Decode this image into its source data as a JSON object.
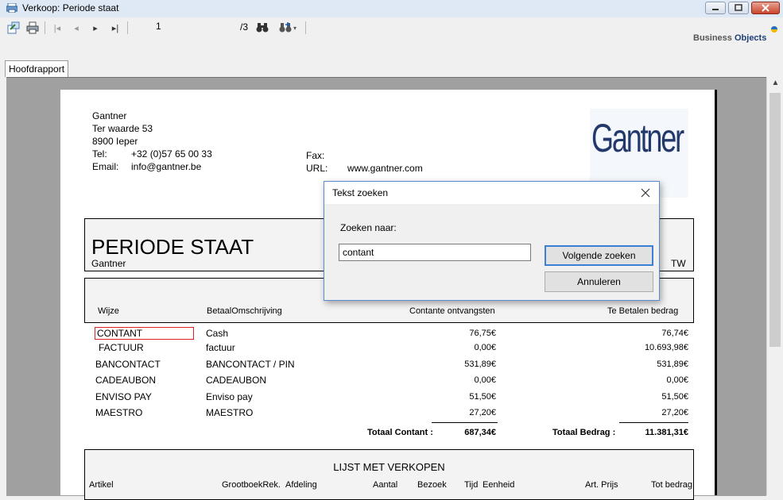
{
  "window": {
    "title": "Verkoop: Periode staat"
  },
  "toolbar": {
    "page_current": "1",
    "page_total": "/3",
    "brand_business": "Business",
    "brand_objects": "Objects"
  },
  "tab": {
    "label": "Hoofdrapport"
  },
  "report": {
    "company": {
      "name": "Gantner",
      "street": "Ter waarde  53",
      "city": "8900 Ieper",
      "tel_label": "Tel:",
      "tel_value": "+32 (0)57 65 00 33",
      "email_label": "Email:",
      "email_value": "info@gantner.be",
      "fax_label": "Fax:",
      "url_label": "URL:",
      "url_value": "www.gantner.com",
      "logo_text": "Gantner"
    },
    "title": "PERIODE STAAT",
    "subtitle": "Gantner",
    "partial_text": "TW",
    "payments": {
      "headers": {
        "wijze": "Wijze",
        "omschrijving": "BetaalOmschrijving",
        "contant": "Contante ontvangsten",
        "te_betalen": "Te Betalen bedrag"
      },
      "rows": [
        {
          "wijze": "CONTANT",
          "omschrijving": "Cash",
          "contant": "76,75€",
          "te_betalen": "76,74€"
        },
        {
          "wijze": "FACTUUR",
          "omschrijving": "factuur",
          "contant": "0,00€",
          "te_betalen": "10.693,98€"
        },
        {
          "wijze": "BANCONTACT",
          "omschrijving": "BANCONTACT / PIN",
          "contant": "531,89€",
          "te_betalen": "531,89€"
        },
        {
          "wijze": "CADEAUBON",
          "omschrijving": "CADEAUBON",
          "contant": "0,00€",
          "te_betalen": "0,00€"
        },
        {
          "wijze": "ENVISO PAY",
          "omschrijving": "Enviso pay",
          "contant": "51,50€",
          "te_betalen": "51,50€"
        },
        {
          "wijze": "MAESTRO",
          "omschrijving": "MAESTRO",
          "contant": "27,20€",
          "te_betalen": "27,20€"
        }
      ],
      "totaal_contant_label": "Totaal Contant :",
      "totaal_contant_value": "687,34€",
      "totaal_bedrag_label": "Totaal Bedrag :",
      "totaal_bedrag_value": "11.381,31€"
    },
    "sales": {
      "title": "LIJST MET VERKOPEN",
      "headers": {
        "artikel": "Artikel",
        "grootboek": "GrootboekRek.",
        "afdeling": "Afdeling",
        "aantal": "Aantal",
        "bezoek": "Bezoek",
        "tijd": "Tijd",
        "eenheid": "Eenheid",
        "art_prijs": "Art. Prijs",
        "tot_bedrag": "Tot bedrag"
      }
    }
  },
  "dialog": {
    "title": "Tekst zoeken",
    "label": "Zoeken naar:",
    "input_value": "contant",
    "next_button": "Volgende zoeken",
    "cancel_button": "Annuleren"
  }
}
